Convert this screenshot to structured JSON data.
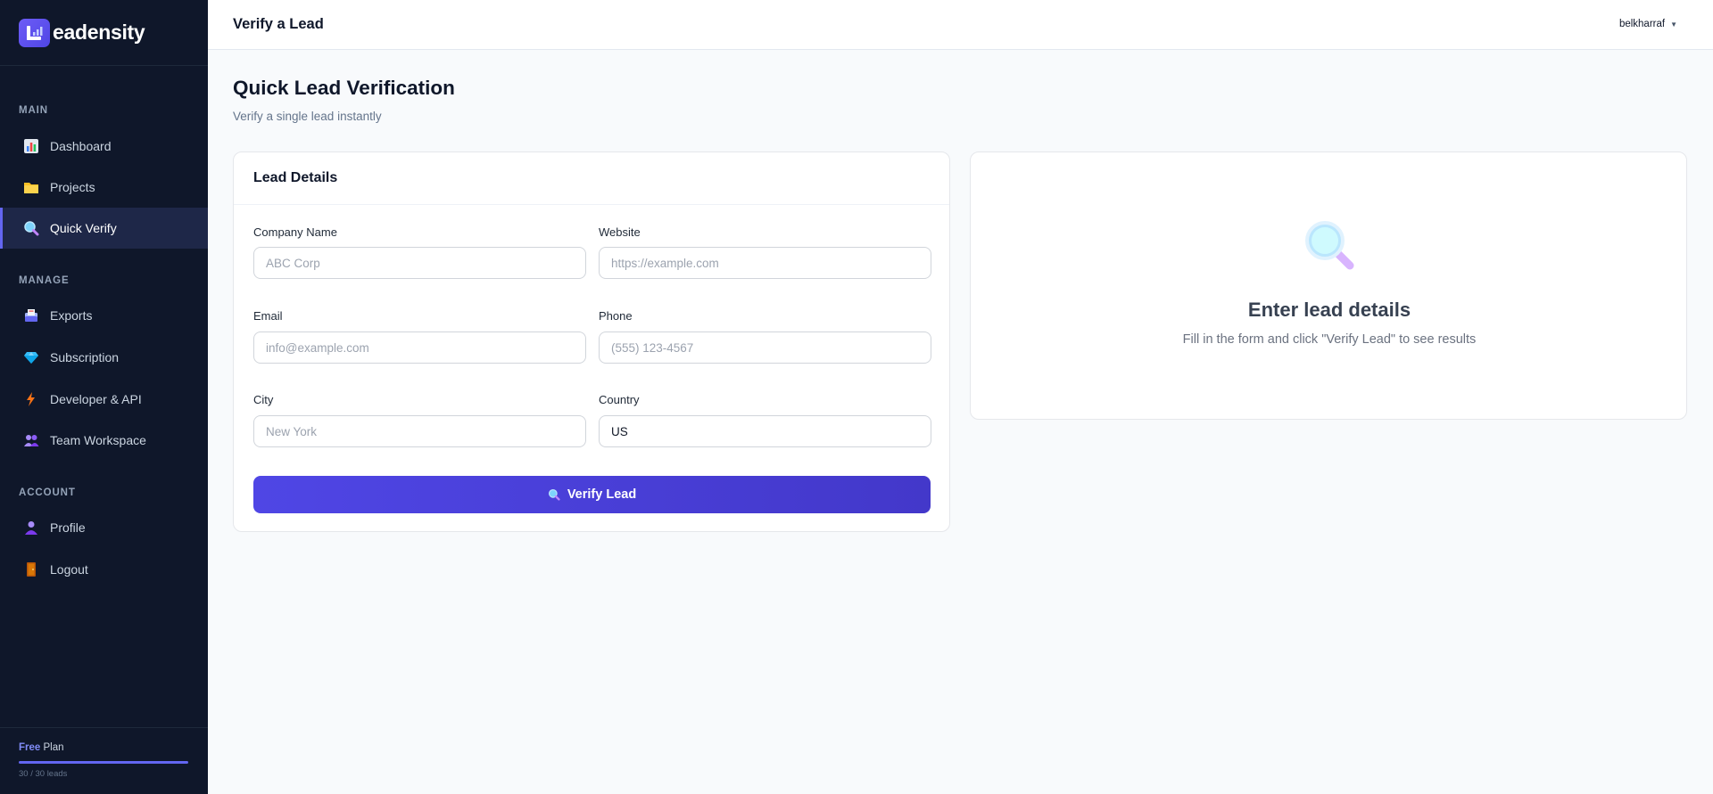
{
  "brand": {
    "name": "eadensity",
    "logo_letter": "L"
  },
  "sidebar": {
    "sections": [
      {
        "label": "MAIN"
      },
      {
        "label": "MANAGE"
      },
      {
        "label": "ACCOUNT"
      }
    ],
    "items": [
      {
        "label": "Dashboard",
        "icon": "bar-chart-icon"
      },
      {
        "label": "Projects",
        "icon": "folder-icon"
      },
      {
        "label": "Quick Verify",
        "icon": "magnifier-icon",
        "active": true
      },
      {
        "label": "Exports",
        "icon": "inbox-icon"
      },
      {
        "label": "Subscription",
        "icon": "diamond-icon"
      },
      {
        "label": "Developer & API",
        "icon": "lightning-icon"
      },
      {
        "label": "Team Workspace",
        "icon": "people-icon"
      },
      {
        "label": "Profile",
        "icon": "person-icon"
      },
      {
        "label": "Logout",
        "icon": "door-icon"
      }
    ],
    "plan": {
      "free": "Free",
      "plan_word": "Plan",
      "usage": "30 / 30 leads",
      "used_fraction": 1.0
    }
  },
  "topbar": {
    "title": "Verify a Lead",
    "user": "belkharraf",
    "caret": "▼"
  },
  "main": {
    "title": "Quick Lead Verification",
    "subtitle": "Verify a single lead instantly",
    "form": {
      "title": "Lead Details",
      "company": {
        "label": "Company Name",
        "placeholder": "ABC Corp",
        "value": ""
      },
      "website": {
        "label": "Website",
        "placeholder": "https://example.com",
        "value": ""
      },
      "email": {
        "label": "Email",
        "placeholder": "info@example.com",
        "value": ""
      },
      "phone": {
        "label": "Phone",
        "placeholder": "(555) 123-4567",
        "value": ""
      },
      "city": {
        "label": "City",
        "placeholder": "New York",
        "value": ""
      },
      "country": {
        "label": "Country",
        "placeholder": "",
        "value": "US"
      },
      "submit_label": "Verify Lead"
    },
    "result": {
      "title": "Enter lead details",
      "text": "Fill in the form and click \"Verify Lead\" to see results"
    }
  },
  "colors": {
    "accent": "#4f46e5",
    "sidebar_bg": "#0f172a",
    "page_bg": "#f8fafc"
  }
}
